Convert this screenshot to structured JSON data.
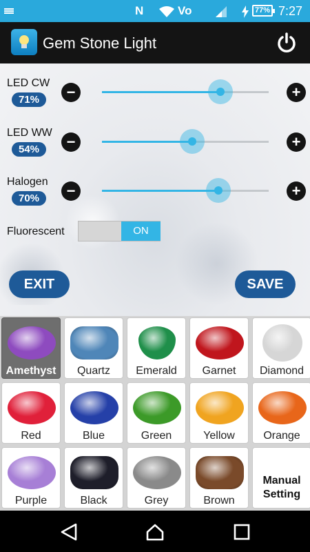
{
  "status_bar": {
    "nfc": "N",
    "volte": "Vo",
    "battery": "77%",
    "time": "7:27"
  },
  "app": {
    "title": "Gem Stone Light",
    "icon_name": "lightbulb-icon",
    "power_icon": "power-icon"
  },
  "sliders": [
    {
      "label": "LED CW",
      "value_text": "71%",
      "value": 71
    },
    {
      "label": "LED WW",
      "value_text": "54%",
      "value": 54
    },
    {
      "label": "Halogen",
      "value_text": "70%",
      "value": 70
    }
  ],
  "buttons": {
    "minus": "−",
    "plus": "+",
    "exit": "EXIT",
    "save": "SAVE"
  },
  "fluorescent": {
    "label": "Fluorescent",
    "state": "ON"
  },
  "colors": {
    "accent": "#33b5e5",
    "badge": "#1e5a98",
    "status_bar": "#2aa9dc",
    "title_bar": "#141414"
  },
  "gems": [
    {
      "name": "Amethyst",
      "color": "#8e4bbf",
      "selected": true
    },
    {
      "name": "Quartz",
      "color": "#4f86b8"
    },
    {
      "name": "Emerald",
      "color": "#1f8f4a"
    },
    {
      "name": "Garnet",
      "color": "#c0161d"
    },
    {
      "name": "Diamond",
      "color": "#d6d6d6"
    },
    {
      "name": "Red",
      "color": "#e0203a"
    },
    {
      "name": "Blue",
      "color": "#2540a8"
    },
    {
      "name": "Green",
      "color": "#3c9a28"
    },
    {
      "name": "Yellow",
      "color": "#f0a420"
    },
    {
      "name": "Orange",
      "color": "#e8661a"
    },
    {
      "name": "Purple",
      "color": "#a77fd6"
    },
    {
      "name": "Black",
      "color": "#1e1e2a"
    },
    {
      "name": "Grey",
      "color": "#8a8a8a"
    },
    {
      "name": "Brown",
      "color": "#7a4a2a"
    }
  ],
  "manual": {
    "line1": "Manual",
    "line2": "Setting"
  },
  "nav": {
    "back": "back-icon",
    "home": "home-icon",
    "recents": "recents-icon"
  }
}
